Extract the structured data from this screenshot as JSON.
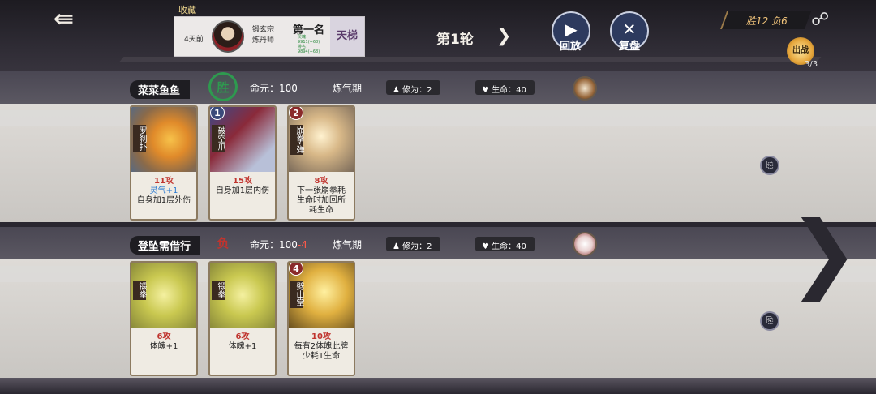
{
  "header": {
    "back_icon": "back-arrow-icon",
    "favorite_label": "收藏",
    "record": {
      "time": "4天前",
      "sect_line1": "锻玄宗",
      "sect_line2": "炼丹师",
      "rank": "第一名",
      "stat_line1": "灵魄：",
      "stat_line2": "9911(+68)",
      "stat_line3": "排名：",
      "stat_line4": "9894(+68)",
      "ladder": "天梯"
    },
    "round_title": "第1轮",
    "replay_label": "回放",
    "review_label": "复盘",
    "win_loss": "胜12  负6",
    "chuzhan_label": "出战",
    "chuzhan_count": "3/3"
  },
  "players": [
    {
      "name": "菜菜鱼鱼",
      "result": "胜",
      "life_label": "命元：",
      "life_value": "100",
      "life_delta": "",
      "realm": "炼气期",
      "cultivation": "修为：2",
      "hp": "生命：40",
      "cards": [
        {
          "name": "罗刹扑",
          "cost": "",
          "atk": "11攻",
          "line2": "灵气+1",
          "line3": "自身加1层外伤"
        },
        {
          "name": "破空爪",
          "cost": "1",
          "atk": "15攻",
          "line2": "自身加1层内伤",
          "line3": ""
        },
        {
          "name": "崩拳·弹",
          "cost": "2",
          "atk": "8攻",
          "line2": "下一张崩拳耗",
          "line3": "生命时加回所",
          "line4": "耗生命"
        }
      ]
    },
    {
      "name": "登坠需借行",
      "result": "负",
      "life_label": "命元：",
      "life_value": "100",
      "life_delta": "-4",
      "realm": "炼气期",
      "cultivation": "修为：2",
      "hp": "生命：40",
      "cards": [
        {
          "name": "锻拳",
          "cost": "",
          "atk": "6攻",
          "line2": "体魄+1",
          "line3": ""
        },
        {
          "name": "锻拳",
          "cost": "",
          "atk": "6攻",
          "line2": "体魄+1",
          "line3": ""
        },
        {
          "name": "劈山掌",
          "cost": "4",
          "atk": "10攻",
          "line2": "每有2体魄此牌",
          "line3": "少耗1生命"
        }
      ]
    }
  ],
  "colors": {
    "win": "#2e9a4f",
    "lose": "#c0342e",
    "attack": "#c0342e",
    "accent_gold": "#f0c37a"
  }
}
